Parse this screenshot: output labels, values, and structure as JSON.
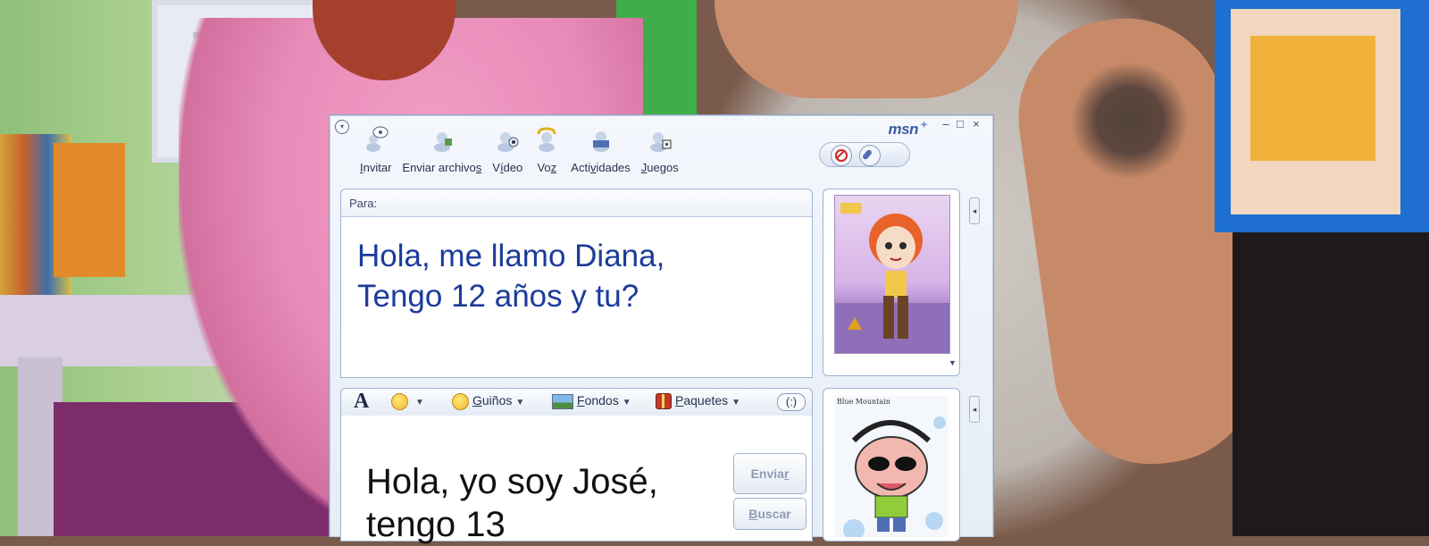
{
  "window": {
    "brand": "msn",
    "controls": {
      "minimize": "–",
      "maximize": "□",
      "close": "×"
    }
  },
  "toolbar": [
    {
      "name": "invite",
      "pre": "",
      "u": "I",
      "post": "nvitar",
      "icon": "invite-icon"
    },
    {
      "name": "send-files",
      "pre": "Enviar archivo",
      "u": "s",
      "post": "",
      "icon": "send-files-icon"
    },
    {
      "name": "video",
      "pre": "V",
      "u": "í",
      "post": "deo",
      "icon": "webcam-icon"
    },
    {
      "name": "voice",
      "pre": "Vo",
      "u": "z",
      "post": "",
      "icon": "voice-icon"
    },
    {
      "name": "activities",
      "pre": "Acti",
      "u": "v",
      "post": "idades",
      "icon": "activities-icon"
    },
    {
      "name": "games",
      "pre": "",
      "u": "J",
      "post": "uegos",
      "icon": "games-icon"
    }
  ],
  "conversation": {
    "to_label": "Para:",
    "received_line1": "Hola, me llamo Diana,",
    "received_line2": "Tengo 12 años y tu?"
  },
  "format_bar": {
    "font_glyph": "A",
    "winks_pre": "",
    "winks_u": "G",
    "winks_post": "uiños",
    "backgrounds_pre": "",
    "backgrounds_u": "F",
    "backgrounds_post": "ondos",
    "packs_pre": "",
    "packs_u": "P",
    "packs_post": "aquetes",
    "nudge": "(:)"
  },
  "compose": {
    "line1": "Hola, yo soy José,",
    "line2": "tengo 13"
  },
  "buttons": {
    "send_pre": "Envia",
    "send_u": "r",
    "search_pre": "",
    "search_u": "B",
    "search_post": "uscar"
  },
  "display_pictures": {
    "contact_caption": "Blue Mountain"
  },
  "colors": {
    "received_text": "#1c3c9a",
    "window_border": "#8ea3c4",
    "brand": "#3c5da3"
  }
}
